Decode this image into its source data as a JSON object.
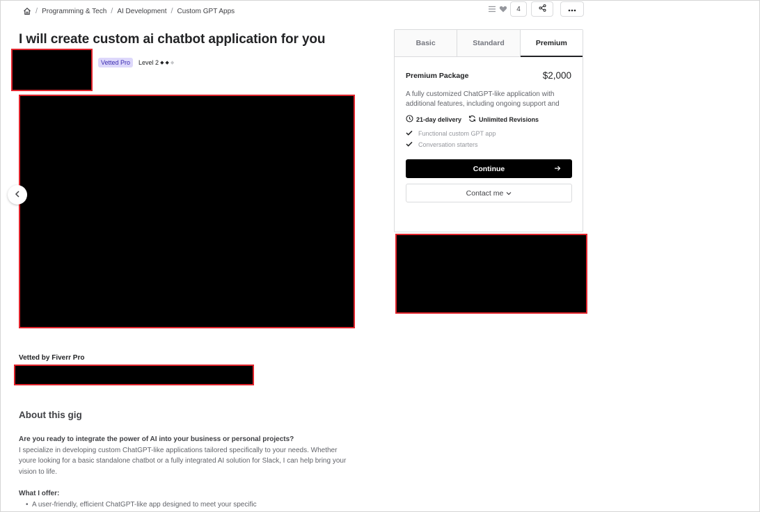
{
  "breadcrumb": {
    "items": [
      "Programming & Tech",
      "AI Development",
      "Custom GPT Apps"
    ]
  },
  "actions": {
    "like_count": "4"
  },
  "gig": {
    "title": "I will create custom ai chatbot application for you",
    "badge": "Vetted Pro",
    "level": "Level 2"
  },
  "vetted_by": "Vetted by Fiverr Pro",
  "about": {
    "title": "About this gig",
    "lead": "Are you ready to integrate the power of AI into your business or personal projects?",
    "body": "I specialize in developing custom ChatGPT-like applications tailored specifically to your needs. Whether youre looking for a basic standalone chatbot or a fully integrated AI solution for Slack, I can help bring your vision to life.",
    "offer_heading": "What I offer:",
    "offers": [
      "A user-friendly, efficient ChatGPT-like app designed to meet your specific"
    ]
  },
  "package_card": {
    "tabs": [
      "Basic",
      "Standard",
      "Premium"
    ],
    "active_tab": "Premium",
    "name": "Premium Package",
    "price": "$2,000",
    "description": "A fully customized ChatGPT-like application with additional features, including ongoing support and",
    "delivery": "21-day delivery",
    "revisions": "Unlimited Revisions",
    "features": [
      "Functional custom GPT app",
      "Conversation starters"
    ],
    "continue_label": "Continue",
    "contact_label": "Contact me"
  },
  "colors": {
    "redaction_border": "#e0242c",
    "badge_bg": "#ddd8fb",
    "badge_text": "#3a2bb0",
    "primary_button": "#000000"
  },
  "icons": [
    "home-icon",
    "list-icon",
    "heart-icon",
    "share-icon",
    "more-icon",
    "chevron-left-icon",
    "clock-icon",
    "refresh-icon",
    "check-icon",
    "arrow-right-icon",
    "chevron-down-icon"
  ]
}
